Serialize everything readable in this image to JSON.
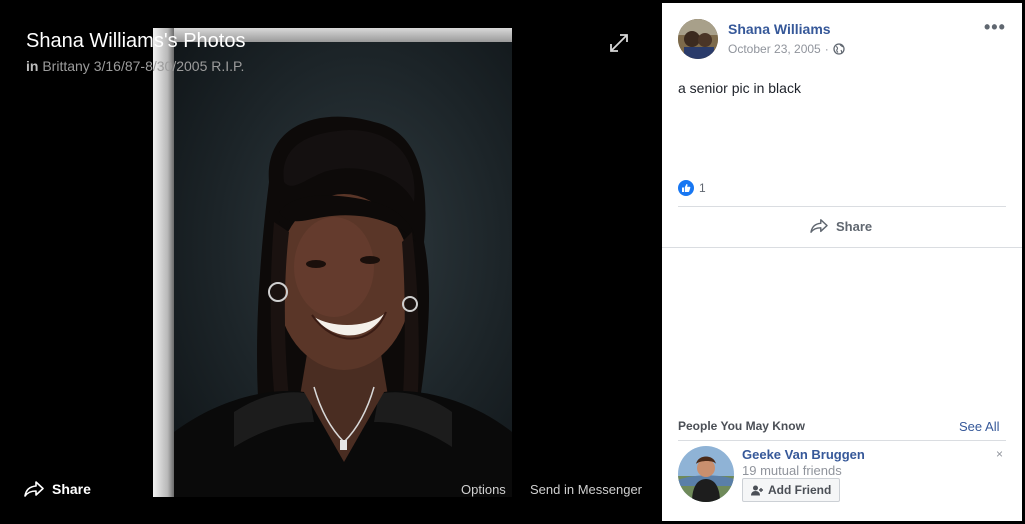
{
  "viewer": {
    "title": "Shana Williams's Photos",
    "album_prefix": "in",
    "album_name": "Brittany 3/16/87-8/30/2005 R.I.P.",
    "share_label": "Share",
    "options_label": "Options",
    "messenger_label": "Send in Messenger"
  },
  "post": {
    "author": "Shana Williams",
    "date": "October 23, 2005",
    "date_separator": "·",
    "privacy_icon": "globe-icon",
    "more_label": "•••",
    "caption": "a senior pic in black",
    "like_count": "1",
    "share_label": "Share"
  },
  "people_you_may_know": {
    "title": "People You May Know",
    "see_all_label": "See All",
    "people": [
      {
        "name": "Geeke Van Bruggen",
        "mutual_friends": "19 mutual friends",
        "add_friend_label": "Add Friend",
        "dismiss_label": "×"
      }
    ]
  },
  "colors": {
    "link": "#365899",
    "like_blue": "#1877f2",
    "viewer_bg": "#000000",
    "panel_bg": "#ffffff"
  }
}
